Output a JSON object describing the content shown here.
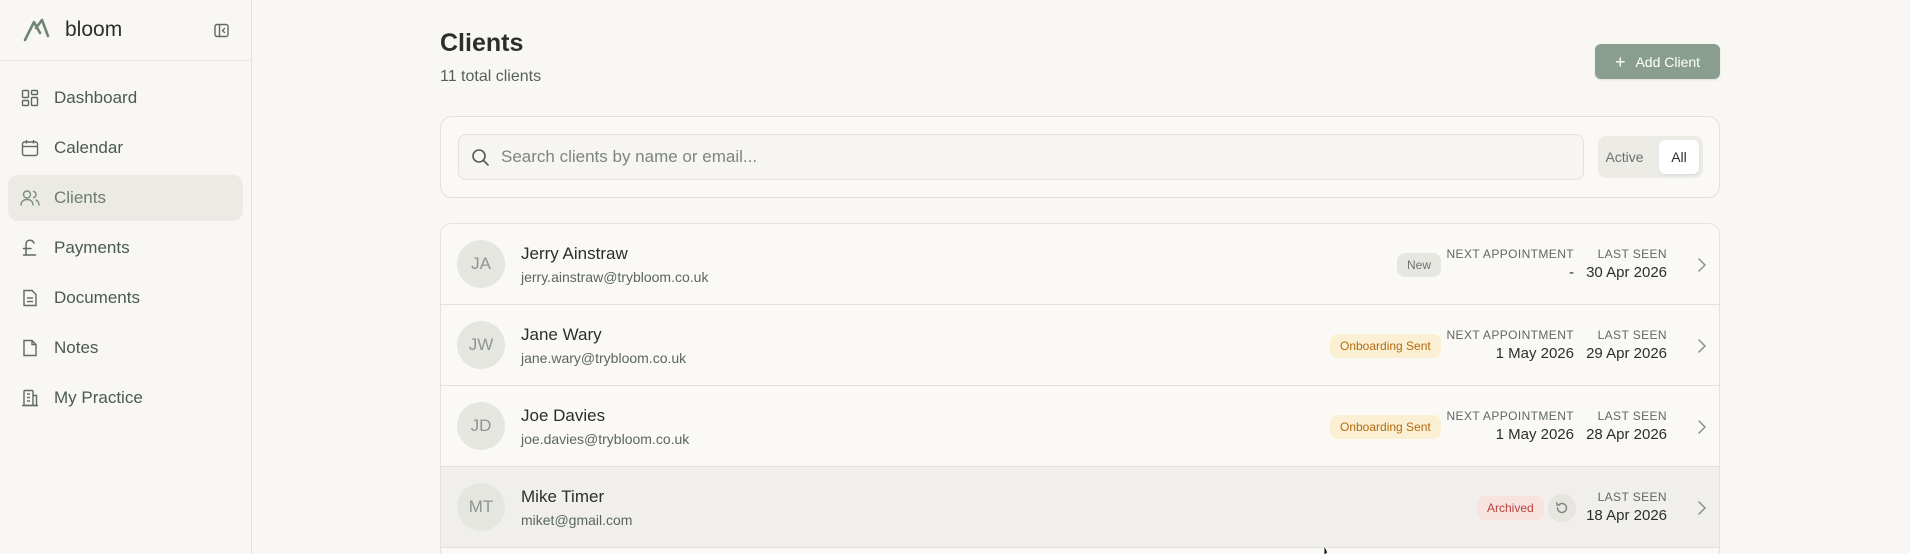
{
  "brand": {
    "name": "bloom",
    "logo_icon": "bloom-logo-icon"
  },
  "sidebar": {
    "items": [
      {
        "label": "Dashboard",
        "icon": "dashboard-icon",
        "active": false
      },
      {
        "label": "Calendar",
        "icon": "calendar-icon",
        "active": false
      },
      {
        "label": "Clients",
        "icon": "users-icon",
        "active": true
      },
      {
        "label": "Payments",
        "icon": "pound-icon",
        "active": false
      },
      {
        "label": "Documents",
        "icon": "document-icon",
        "active": false
      },
      {
        "label": "Notes",
        "icon": "note-icon",
        "active": false
      },
      {
        "label": "My Practice",
        "icon": "building-icon",
        "active": false
      }
    ]
  },
  "page": {
    "title": "Clients",
    "subtitle": "11 total clients",
    "add_button_label": "Add Client"
  },
  "search": {
    "placeholder": "Search clients by name or email...",
    "value": "",
    "filter_options": [
      "Active",
      "All"
    ],
    "selected_filter": "All"
  },
  "clients": [
    {
      "initials": "JA",
      "name": "Jerry Ainstraw",
      "email": "jerry.ainstraw@trybloom.co.uk",
      "status": "New",
      "next_label": "NEXT APPOINTMENT",
      "next_value": "-",
      "seen_label": "LAST SEEN",
      "seen_value": "30 Apr 2026"
    },
    {
      "initials": "JW",
      "name": "Jane Wary",
      "email": "jane.wary@trybloom.co.uk",
      "status": "Onboarding Sent",
      "next_label": "NEXT APPOINTMENT",
      "next_value": "1 May 2026",
      "seen_label": "LAST SEEN",
      "seen_value": "29 Apr 2026"
    },
    {
      "initials": "JD",
      "name": "Joe Davies",
      "email": "joe.davies@trybloom.co.uk",
      "status": "Onboarding Sent",
      "next_label": "NEXT APPOINTMENT",
      "next_value": "1 May 2026",
      "seen_label": "LAST SEEN",
      "seen_value": "28 Apr 2026"
    },
    {
      "initials": "MT",
      "name": "Mike Timer",
      "email": "miket@gmail.com",
      "status": "Archived",
      "restore_icon": "restore-icon",
      "seen_label": "LAST SEEN",
      "seen_value": "18 Apr 2026"
    }
  ],
  "colors": {
    "accent": "#8a9e90",
    "sidebar_active_bg": "#eceae5",
    "badge_onboarding": "#b26a11",
    "badge_archived": "#b6433a"
  }
}
